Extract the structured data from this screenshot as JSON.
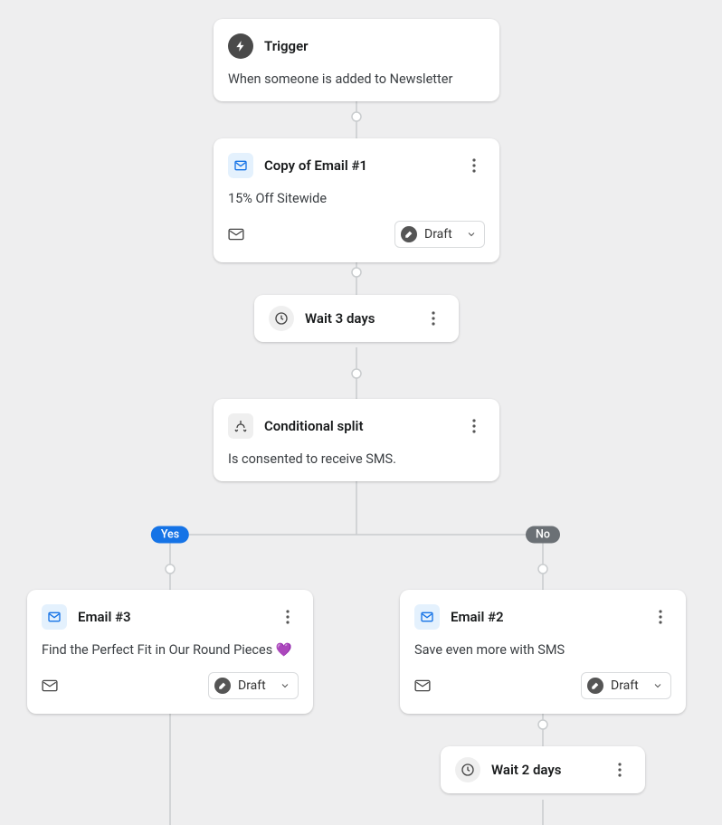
{
  "trigger": {
    "title": "Trigger",
    "description": "When someone is added to Newsletter"
  },
  "email1": {
    "title": "Copy of Email #1",
    "description": "15% Off Sitewide",
    "status": "Draft"
  },
  "wait1": {
    "title": "Wait 3 days"
  },
  "split": {
    "title": "Conditional split",
    "description": "Is consented to receive SMS.",
    "yes_label": "Yes",
    "no_label": "No"
  },
  "email3": {
    "title": "Email #3",
    "description": "Find the Perfect Fit in Our Round Pieces 💜",
    "status": "Draft"
  },
  "email2": {
    "title": "Email #2",
    "description": "Save even more with SMS",
    "status": "Draft"
  },
  "wait2": {
    "title": "Wait 2 days"
  }
}
